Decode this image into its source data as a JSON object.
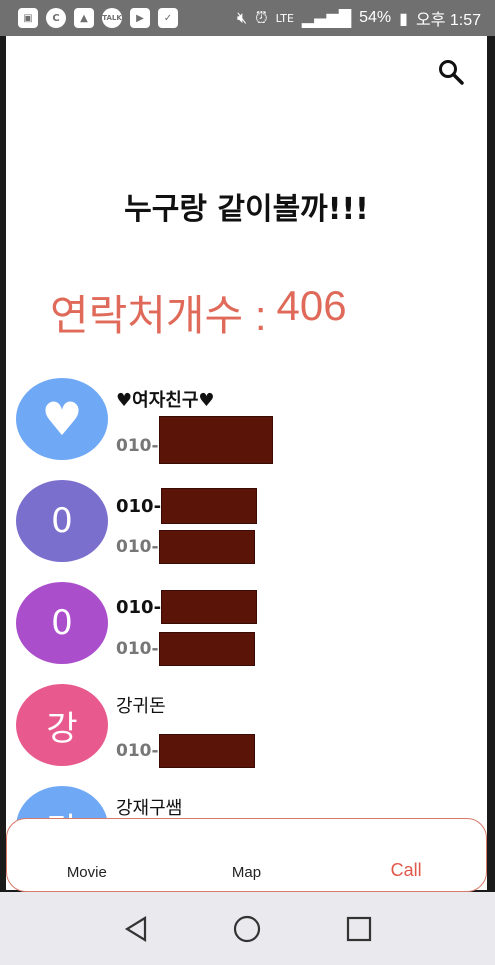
{
  "status_bar": {
    "left_icons": [
      "facetime-icon",
      "c-icon",
      "gallery-icon",
      "talk-icon",
      "youtube-icon",
      "checkbox-icon"
    ],
    "talk_label": "TALK",
    "c_label": "C",
    "battery": "54%",
    "time": "오후 1:57"
  },
  "header": {
    "search_icon": "search-icon"
  },
  "main": {
    "title": "누구랑 같이볼까!!!",
    "count_label": "연락처개수 :",
    "count_value": "406"
  },
  "contacts": [
    {
      "avatar": "♥",
      "name": "♥여자친구♥",
      "phone_prefix": "010-",
      "color": "#6fa8f5"
    },
    {
      "avatar": "0",
      "name": "010-",
      "phone_prefix": "010-",
      "color": "#7b6fce"
    },
    {
      "avatar": "0",
      "name": "010-",
      "phone_prefix": "010-",
      "color": "#ab4ecb"
    },
    {
      "avatar": "강",
      "name": "강귀돈",
      "phone_prefix": "010-",
      "color": "#e85a8d"
    },
    {
      "avatar": "강",
      "name": "강재구쌤",
      "phone_prefix": "",
      "color": "#6fa8f5"
    }
  ],
  "bottom_nav": {
    "movie": "Movie",
    "map": "Map",
    "call": "Call",
    "active": "Call",
    "accent": "#e0584a"
  },
  "system_nav": [
    "back-icon",
    "home-icon",
    "recents-icon"
  ]
}
